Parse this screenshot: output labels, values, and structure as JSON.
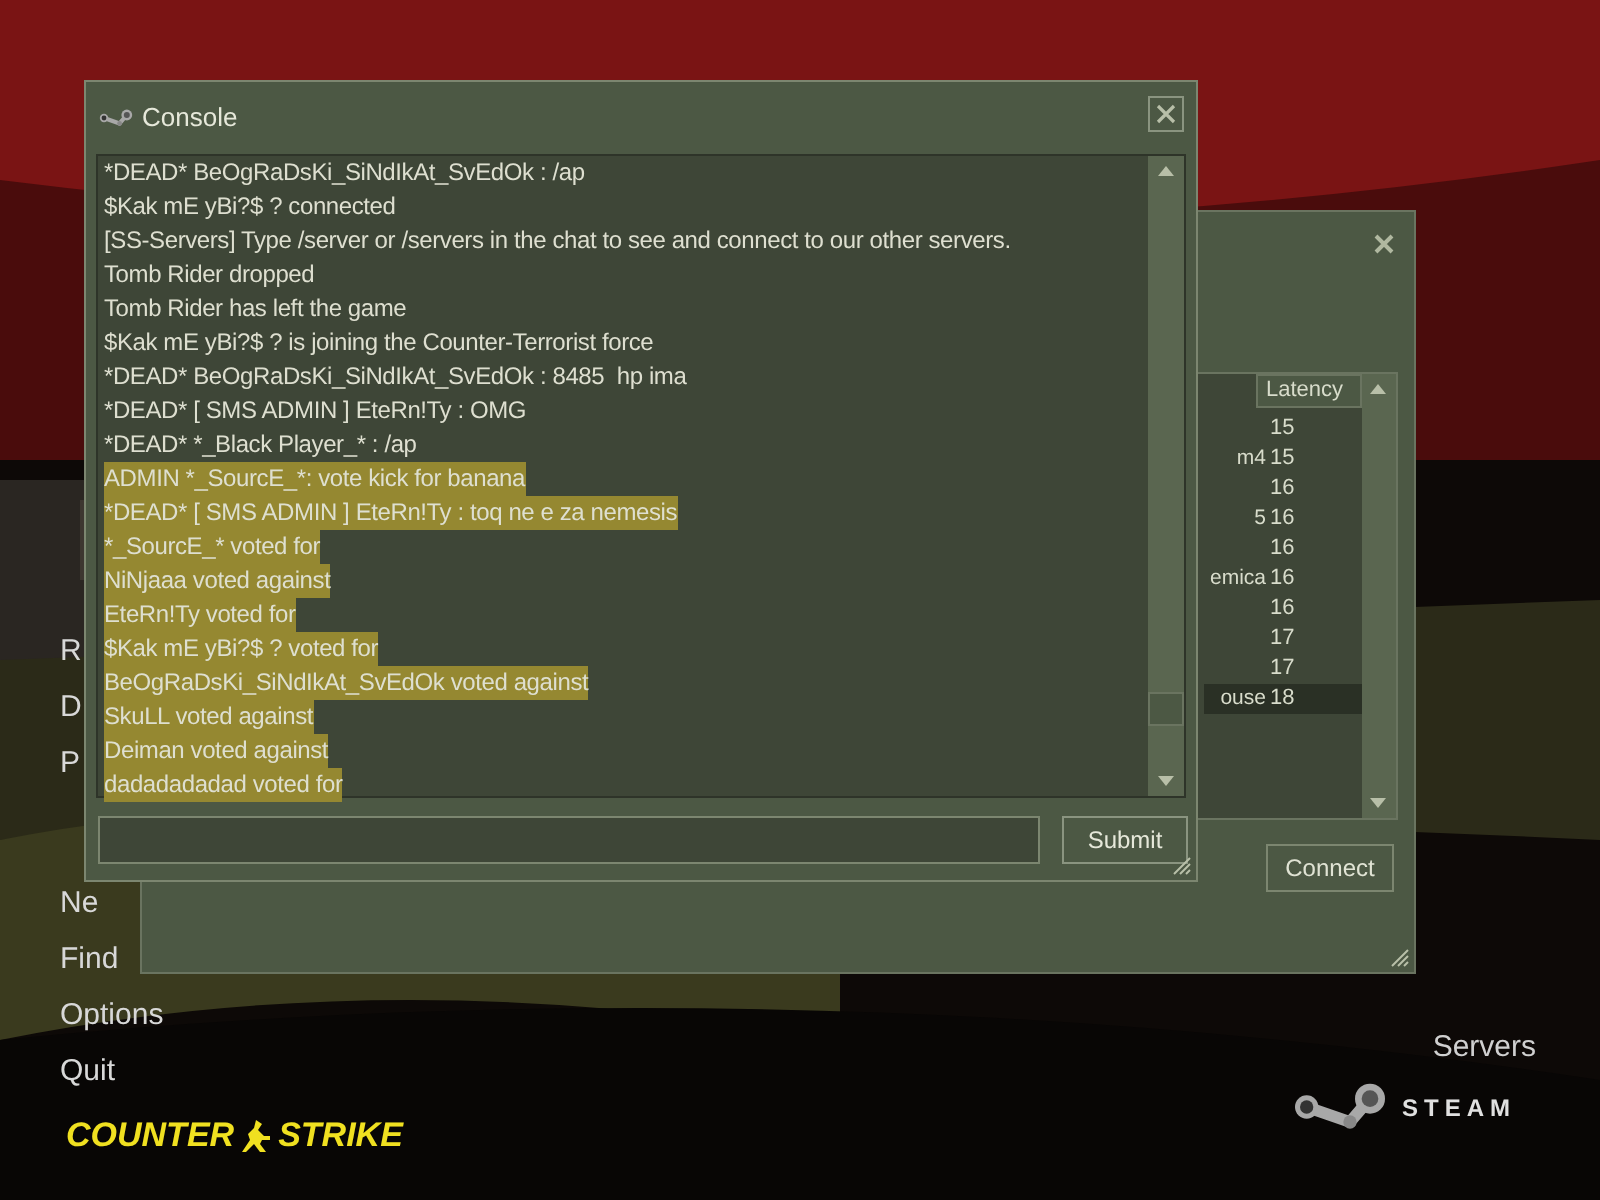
{
  "main_menu": [
    {
      "label": "R"
    },
    {
      "label": "D"
    },
    {
      "label": "P"
    },
    {
      "label": "Ne"
    },
    {
      "label": "Find"
    },
    {
      "label": "Options"
    },
    {
      "label": "Quit"
    }
  ],
  "logo": {
    "left": "COUNTER",
    "right": "STRIKE"
  },
  "servers_link": "Servers",
  "steam_logo": "STEAM",
  "server_browser": {
    "columns": [
      "Latency"
    ],
    "rows": [
      {
        "name_part": "",
        "latency": "15",
        "selected": false
      },
      {
        "name_part": "m4",
        "latency": "15",
        "selected": false
      },
      {
        "name_part": "",
        "latency": "16",
        "selected": false
      },
      {
        "name_part": "5",
        "latency": "16",
        "selected": false
      },
      {
        "name_part": "",
        "latency": "16",
        "selected": false
      },
      {
        "name_part": "emica",
        "latency": "16",
        "selected": false
      },
      {
        "name_part": "",
        "latency": "16",
        "selected": false
      },
      {
        "name_part": "",
        "latency": "17",
        "selected": false
      },
      {
        "name_part": "",
        "latency": "17",
        "selected": false
      },
      {
        "name_part": "ouse",
        "latency": "18",
        "selected": true
      }
    ],
    "connect_button": "Connect"
  },
  "console": {
    "title": "Console",
    "lines": [
      {
        "text": "*DEAD* BeOgRaDsKi_SiNdIkAt_SvEdOk : /ap",
        "highlighted": false
      },
      {
        "text": "$Kak mE yBi?$ ? connected",
        "highlighted": false
      },
      {
        "text": "[SS-Servers] Type /server or /servers in the chat to see and connect to our other servers.",
        "highlighted": false
      },
      {
        "text": "Tomb Rider dropped",
        "highlighted": false
      },
      {
        "text": "Tomb Rider has left the game",
        "highlighted": false
      },
      {
        "text": "$Kak mE yBi?$ ? is joining the Counter-Terrorist force",
        "highlighted": false
      },
      {
        "text": "*DEAD* BeOgRaDsKi_SiNdIkAt_SvEdOk : 8485  hp ima",
        "highlighted": false
      },
      {
        "text": "*DEAD* [ SMS ADMIN ] EteRn!Ty : OMG",
        "highlighted": false
      },
      {
        "text": "*DEAD* *_Black Player_* : /ap",
        "highlighted": false
      },
      {
        "text": "ADMIN *_SourcE_*: vote kick for banana",
        "highlighted": true
      },
      {
        "text": "*DEAD* [ SMS ADMIN ] EteRn!Ty : toq ne e za nemesis",
        "highlighted": true
      },
      {
        "text": "*_SourcE_* voted for",
        "highlighted": true
      },
      {
        "text": "NiNjaaa voted against",
        "highlighted": true
      },
      {
        "text": "EteRn!Ty voted for",
        "highlighted": true
      },
      {
        "text": "$Kak mE yBi?$ ? voted for",
        "highlighted": true
      },
      {
        "text": "BeOgRaDsKi_SiNdIkAt_SvEdOk voted against",
        "highlighted": true
      },
      {
        "text": "SkuLL voted against",
        "highlighted": true
      },
      {
        "text": "Deiman voted against",
        "highlighted": true
      },
      {
        "text": "dadadadadad voted for",
        "highlighted": true
      }
    ],
    "submit_button": "Submit"
  }
}
